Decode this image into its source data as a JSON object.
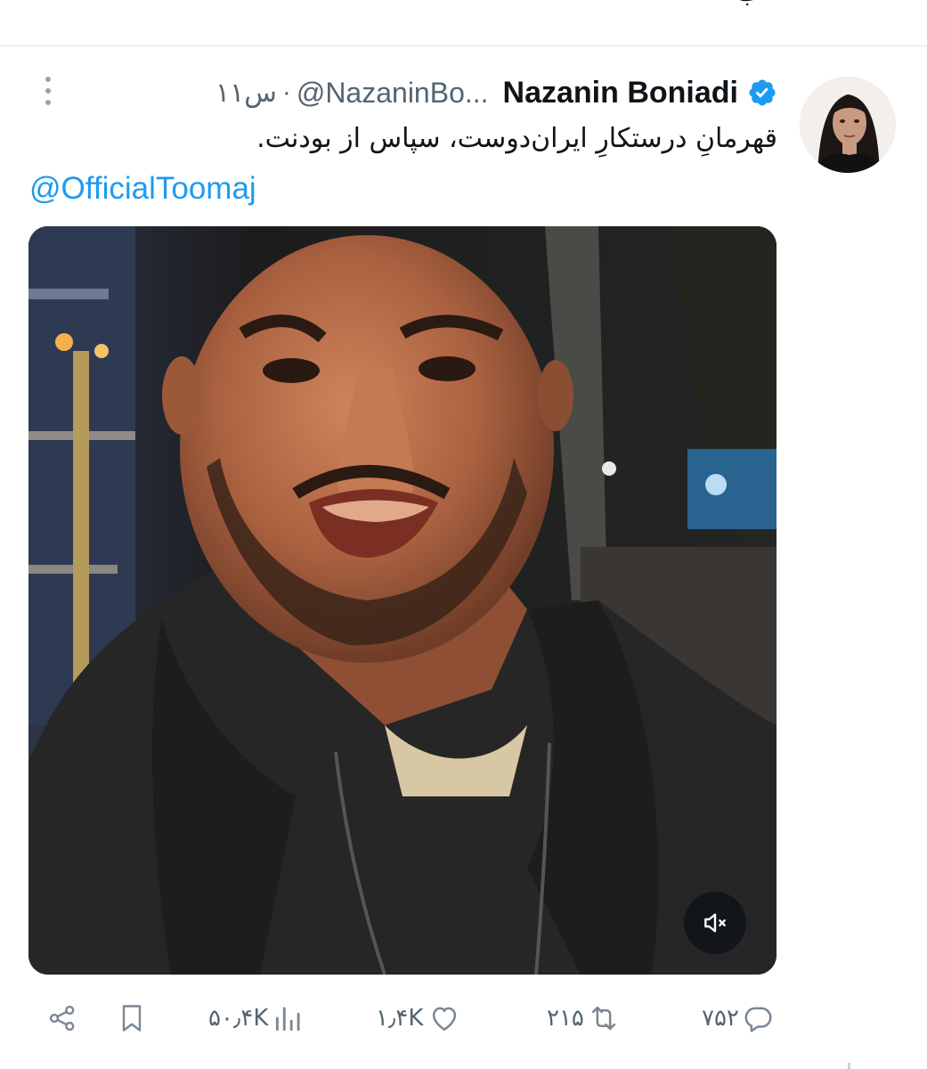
{
  "top_fragment": "ب",
  "tweet": {
    "display_name": "Nazanin Boniadi",
    "handle": "@NazaninBo...",
    "separator": "·",
    "time": "۱۱س",
    "text": "قهرمانِ درستکارِ ایران‌دوست، سپاس از بودنت.",
    "mention": "@OfficialToomaj"
  },
  "icons": {
    "more": "more-vertical-icon",
    "verified": "verified-badge-icon",
    "mute": "volume-muted-icon",
    "share": "share-icon",
    "bookmark": "bookmark-icon",
    "views": "views-chart-icon",
    "like": "heart-icon",
    "retweet": "retweet-icon",
    "reply": "reply-bubble-icon"
  },
  "actions": {
    "views": "۵۰٫۴K",
    "likes": "۱٫۴K",
    "retweets": "۲۱۵",
    "replies": "۷۵۲"
  },
  "colors": {
    "accent": "#1d9bf0",
    "secondary_text": "#536471",
    "primary_text": "#0f1419"
  }
}
